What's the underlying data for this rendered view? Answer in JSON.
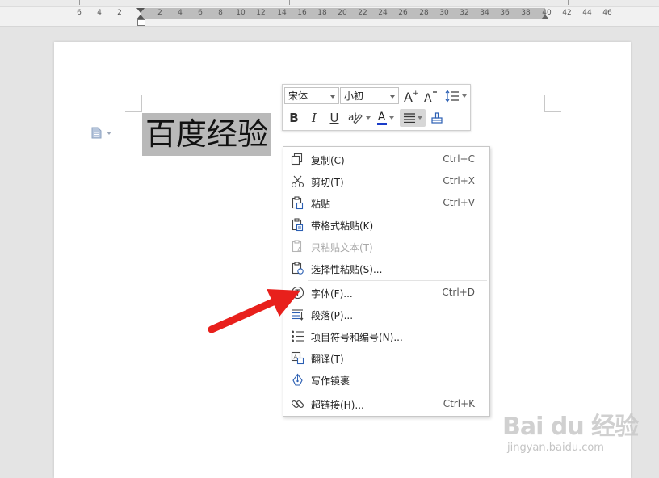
{
  "ruler": {
    "numbers": [
      "6",
      "4",
      "2",
      "2",
      "4",
      "6",
      "8",
      "10",
      "12",
      "14",
      "16",
      "18",
      "20",
      "22",
      "24",
      "26",
      "28",
      "30",
      "32",
      "34",
      "36",
      "38",
      "40",
      "42",
      "44",
      "46"
    ]
  },
  "document": {
    "selected_text": "百度经验"
  },
  "mini_toolbar": {
    "font_name": "宋体",
    "font_size": "小初",
    "bold_label": "B",
    "italic_label": "I",
    "underline_label": "U",
    "font_color_label": "A",
    "grow_label": "A",
    "shrink_label": "A"
  },
  "context_menu": {
    "items": [
      {
        "label": "复制(C)",
        "shortcut": "Ctrl+C",
        "icon": "copy-icon"
      },
      {
        "label": "剪切(T)",
        "shortcut": "Ctrl+X",
        "icon": "scissors-icon"
      },
      {
        "label": "粘贴",
        "shortcut": "Ctrl+V",
        "icon": "paste-icon"
      },
      {
        "label": "带格式粘贴(K)",
        "shortcut": "",
        "icon": "paste-format-icon"
      },
      {
        "label": "只粘贴文本(T)",
        "shortcut": "",
        "icon": "paste-text-icon",
        "disabled": true
      },
      {
        "label": "选择性粘贴(S)...",
        "shortcut": "",
        "icon": "paste-special-icon"
      },
      {
        "label": "字体(F)...",
        "shortcut": "Ctrl+D",
        "icon": "font-icon"
      },
      {
        "label": "段落(P)...",
        "shortcut": "",
        "icon": "paragraph-icon"
      },
      {
        "label": "项目符号和编号(N)...",
        "shortcut": "",
        "icon": "bullets-icon"
      },
      {
        "label": "翻译(T)",
        "shortcut": "",
        "icon": "translate-icon"
      },
      {
        "label": "写作镜裹",
        "shortcut": "",
        "icon": "writing-icon"
      },
      {
        "label": "超链接(H)...",
        "shortcut": "Ctrl+K",
        "icon": "link-icon"
      }
    ]
  },
  "watermark": {
    "logo": "Bai du 经验",
    "url": "jingyan.baidu.com"
  },
  "colors": {
    "selection": "#b9b9b9",
    "arrow": "#e8201c",
    "font_color_bar": "#1a3cc8"
  }
}
